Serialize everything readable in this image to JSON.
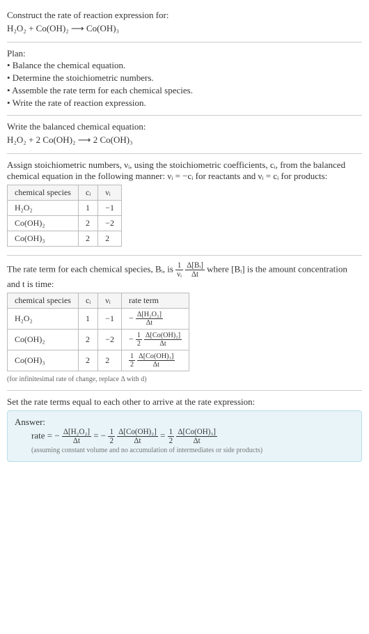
{
  "prompt": {
    "line1": "Construct the rate of reaction expression for:",
    "equation": "H₂O₂ + Co(OH)₂  ⟶  Co(OH)₃"
  },
  "plan": {
    "heading": "Plan:",
    "items": [
      "• Balance the chemical equation.",
      "• Determine the stoichiometric numbers.",
      "• Assemble the rate term for each chemical species.",
      "• Write the rate of reaction expression."
    ]
  },
  "balanced": {
    "heading": "Write the balanced chemical equation:",
    "equation": "H₂O₂ + 2 Co(OH)₂  ⟶  2 Co(OH)₃"
  },
  "stoich": {
    "intro_a": "Assign stoichiometric numbers, νᵢ, using the stoichiometric coefficients, cᵢ, from the balanced chemical equation in the following manner: νᵢ = −cᵢ for reactants and νᵢ = cᵢ for products:",
    "headers": {
      "species": "chemical species",
      "ci": "cᵢ",
      "vi": "νᵢ"
    },
    "rows": [
      {
        "species": "H₂O₂",
        "ci": "1",
        "vi": "−1"
      },
      {
        "species": "Co(OH)₂",
        "ci": "2",
        "vi": "−2"
      },
      {
        "species": "Co(OH)₃",
        "ci": "2",
        "vi": "2"
      }
    ]
  },
  "rate_terms": {
    "intro_a": "The rate term for each chemical species, Bᵢ, is ",
    "intro_b": " where [Bᵢ] is the amount concentration and t is time:",
    "headers": {
      "species": "chemical species",
      "ci": "cᵢ",
      "vi": "νᵢ",
      "rate": "rate term"
    },
    "rows": [
      {
        "species": "H₂O₂",
        "ci": "1",
        "vi": "−1",
        "neg": "−",
        "coef_num": "",
        "coef_den": "",
        "num": "Δ[H₂O₂]",
        "den": "Δt"
      },
      {
        "species": "Co(OH)₂",
        "ci": "2",
        "vi": "−2",
        "neg": "−",
        "coef_num": "1",
        "coef_den": "2",
        "num": "Δ[Co(OH)₂]",
        "den": "Δt"
      },
      {
        "species": "Co(OH)₃",
        "ci": "2",
        "vi": "2",
        "neg": "",
        "coef_num": "1",
        "coef_den": "2",
        "num": "Δ[Co(OH)₃]",
        "den": "Δt"
      }
    ],
    "note": "(for infinitesimal rate of change, replace Δ with d)"
  },
  "final": {
    "intro": "Set the rate terms equal to each other to arrive at the rate expression:",
    "answer_label": "Answer:",
    "rate_label": "rate = ",
    "eq": " = ",
    "neg": "−",
    "t1": {
      "num": "Δ[H₂O₂]",
      "den": "Δt"
    },
    "c2": {
      "num": "1",
      "den": "2"
    },
    "t2": {
      "num": "Δ[Co(OH)₂]",
      "den": "Δt"
    },
    "c3": {
      "num": "1",
      "den": "2"
    },
    "t3": {
      "num": "Δ[Co(OH)₃]",
      "den": "Δt"
    },
    "note": "(assuming constant volume and no accumulation of intermediates or side products)"
  },
  "generic_frac": {
    "one": "1",
    "vi": "νᵢ",
    "dbi": "Δ[Bᵢ]",
    "dt": "Δt"
  }
}
